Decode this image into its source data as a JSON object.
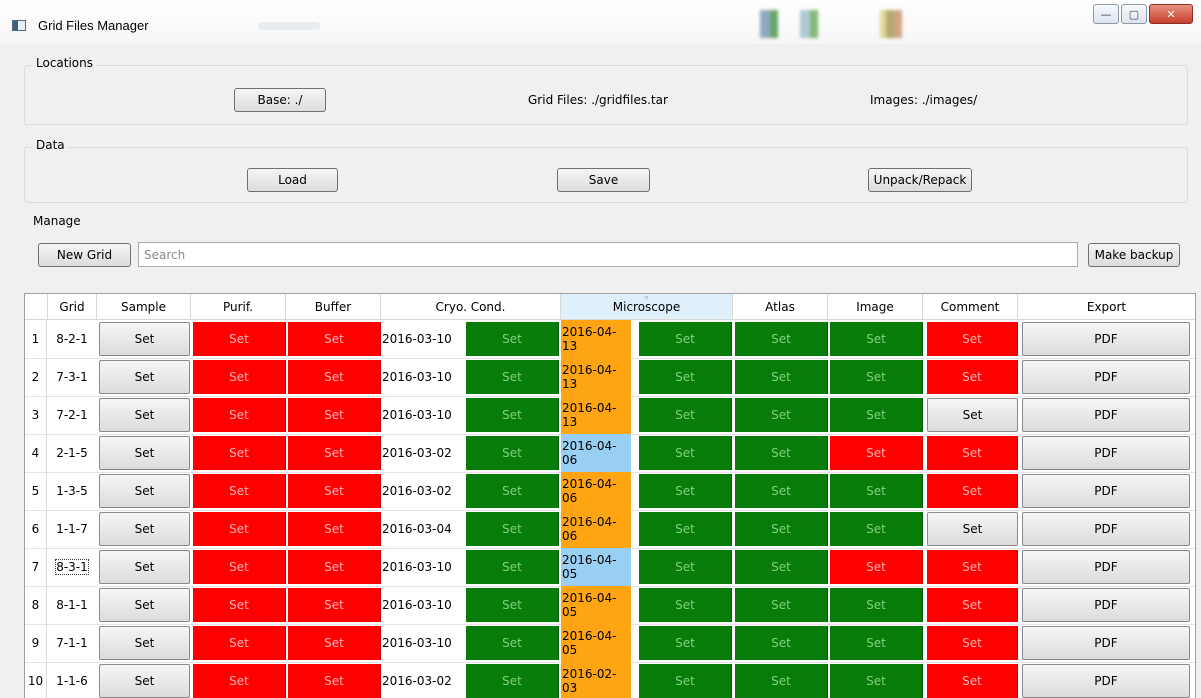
{
  "window": {
    "title": "Grid Files Manager"
  },
  "locations": {
    "title": "Locations",
    "base_label": "Base: ./",
    "grid_files_label": "Grid Files: ./gridfiles.tar",
    "images_label": "Images: ./images/"
  },
  "data_group": {
    "title": "Data",
    "load_label": "Load",
    "save_label": "Save",
    "unpack_label": "Unpack/Repack"
  },
  "manage": {
    "title": "Manage",
    "new_grid_label": "New Grid",
    "search_placeholder": "Search",
    "make_backup_label": "Make backup"
  },
  "table": {
    "headers": [
      "Grid",
      "Sample",
      "Purif.",
      "Buffer",
      "Cryo. Cond.",
      "Microscope",
      "Atlas",
      "Image",
      "Comment",
      "Export"
    ],
    "sorted_column": "Microscope",
    "set_label": "Set",
    "pdf_label": "PDF",
    "colors": {
      "red": "#fe0000",
      "green": "#087c08",
      "orange": "#ffa514",
      "blue": "#99cff2"
    },
    "rows": [
      {
        "num": "1",
        "grid": "8-2-1",
        "cryo_date": "2016-03-10",
        "micro_date": "2016-04-13",
        "micro_date_color": "orange",
        "purif": "red",
        "buffer": "red",
        "cryo": "green",
        "micro": "green",
        "atlas": "green",
        "image": "green",
        "comment": "red"
      },
      {
        "num": "2",
        "grid": "7-3-1",
        "cryo_date": "2016-03-10",
        "micro_date": "2016-04-13",
        "micro_date_color": "orange",
        "purif": "red",
        "buffer": "red",
        "cryo": "green",
        "micro": "green",
        "atlas": "green",
        "image": "green",
        "comment": "red"
      },
      {
        "num": "3",
        "grid": "7-2-1",
        "cryo_date": "2016-03-10",
        "micro_date": "2016-04-13",
        "micro_date_color": "orange",
        "purif": "red",
        "buffer": "red",
        "cryo": "green",
        "micro": "green",
        "atlas": "green",
        "image": "green",
        "comment": "grey"
      },
      {
        "num": "4",
        "grid": "2-1-5",
        "cryo_date": "2016-03-02",
        "micro_date": "2016-04-06",
        "micro_date_color": "blue",
        "purif": "red",
        "buffer": "red",
        "cryo": "green",
        "micro": "green",
        "atlas": "green",
        "image": "red",
        "comment": "red"
      },
      {
        "num": "5",
        "grid": "1-3-5",
        "cryo_date": "2016-03-02",
        "micro_date": "2016-04-06",
        "micro_date_color": "orange",
        "purif": "red",
        "buffer": "red",
        "cryo": "green",
        "micro": "green",
        "atlas": "green",
        "image": "green",
        "comment": "red"
      },
      {
        "num": "6",
        "grid": "1-1-7",
        "cryo_date": "2016-03-04",
        "micro_date": "2016-04-06",
        "micro_date_color": "orange",
        "purif": "red",
        "buffer": "red",
        "cryo": "green",
        "micro": "green",
        "atlas": "green",
        "image": "green",
        "comment": "grey"
      },
      {
        "num": "7",
        "grid": "8-3-1",
        "cryo_date": "2016-03-10",
        "micro_date": "2016-04-05",
        "micro_date_color": "blue",
        "purif": "red",
        "buffer": "red",
        "cryo": "green",
        "micro": "green",
        "atlas": "green",
        "image": "red",
        "comment": "red",
        "focused": true
      },
      {
        "num": "8",
        "grid": "8-1-1",
        "cryo_date": "2016-03-10",
        "micro_date": "2016-04-05",
        "micro_date_color": "orange",
        "purif": "red",
        "buffer": "red",
        "cryo": "green",
        "micro": "green",
        "atlas": "green",
        "image": "green",
        "comment": "red"
      },
      {
        "num": "9",
        "grid": "7-1-1",
        "cryo_date": "2016-03-10",
        "micro_date": "2016-04-05",
        "micro_date_color": "orange",
        "purif": "red",
        "buffer": "red",
        "cryo": "green",
        "micro": "green",
        "atlas": "green",
        "image": "green",
        "comment": "red"
      },
      {
        "num": "10",
        "grid": "1-1-6",
        "cryo_date": "2016-03-02",
        "micro_date": "2016-02-03",
        "micro_date_color": "orange",
        "purif": "red",
        "buffer": "red",
        "cryo": "green",
        "micro": "green",
        "atlas": "green",
        "image": "green",
        "comment": "red"
      }
    ]
  }
}
